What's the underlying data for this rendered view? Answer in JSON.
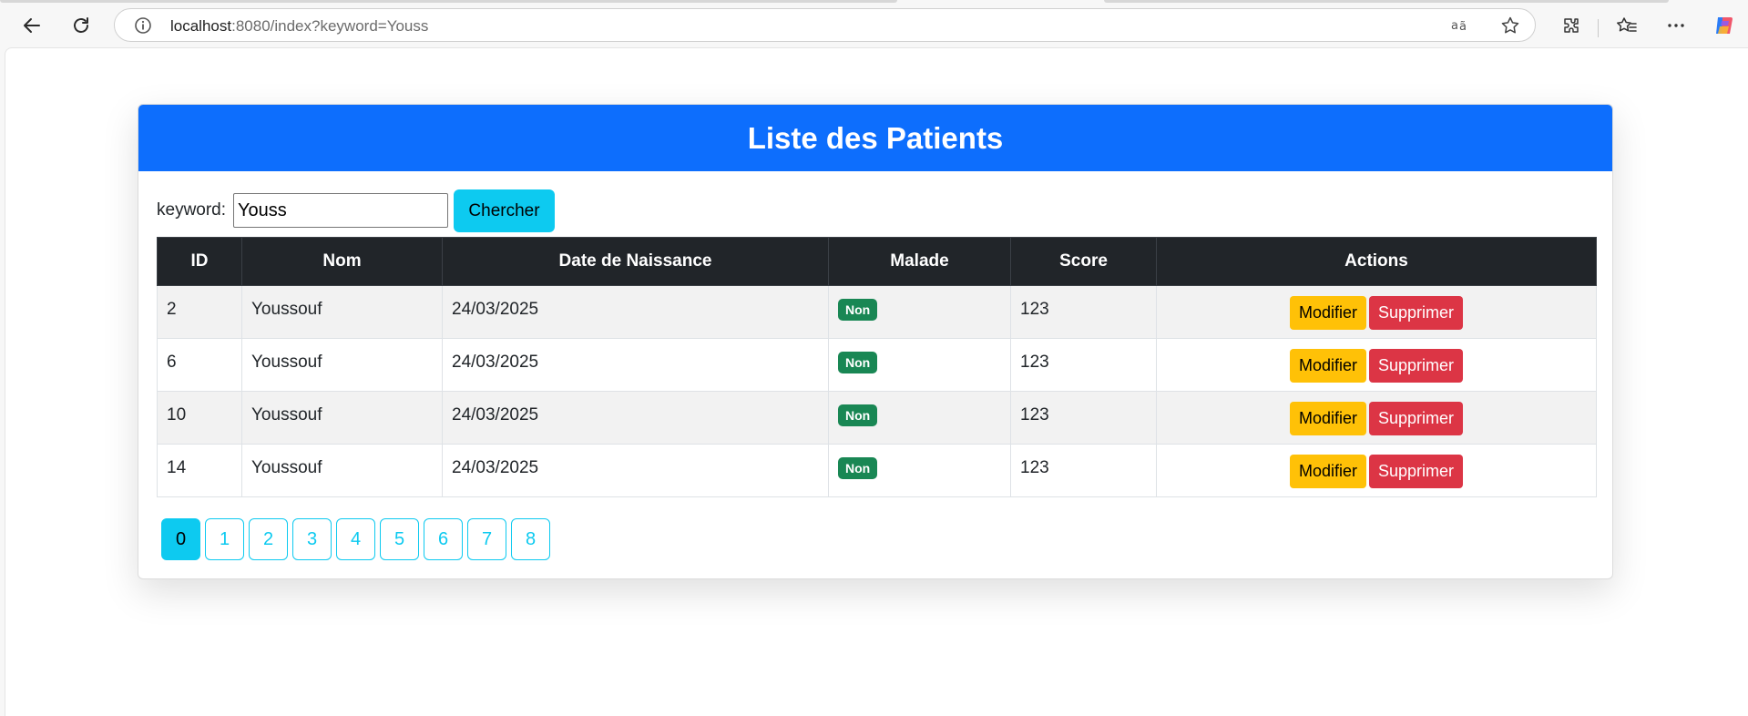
{
  "browser": {
    "url_host": "localhost",
    "url_rest": ":8080/index?keyword=Youss"
  },
  "page": {
    "title": "Liste des Patients",
    "search": {
      "label": "keyword:",
      "value": "Youss",
      "button": "Chercher"
    },
    "table": {
      "headers": [
        "ID",
        "Nom",
        "Date de Naissance",
        "Malade",
        "Score",
        "Actions"
      ],
      "rows": [
        {
          "id": "2",
          "nom": "Youssouf",
          "date": "24/03/2025",
          "malade": "Non",
          "score": "123"
        },
        {
          "id": "6",
          "nom": "Youssouf",
          "date": "24/03/2025",
          "malade": "Non",
          "score": "123"
        },
        {
          "id": "10",
          "nom": "Youssouf",
          "date": "24/03/2025",
          "malade": "Non",
          "score": "123"
        },
        {
          "id": "14",
          "nom": "Youssouf",
          "date": "24/03/2025",
          "malade": "Non",
          "score": "123"
        }
      ],
      "edit_label": "Modifier",
      "delete_label": "Supprimer"
    },
    "pagination": {
      "pages": [
        "0",
        "1",
        "2",
        "3",
        "4",
        "5",
        "6",
        "7",
        "8"
      ],
      "active": "0"
    }
  },
  "colors": {
    "header": "#0d6efd",
    "info": "#0dcaf0",
    "success": "#198754",
    "warning": "#ffc107",
    "danger": "#dc3545",
    "dark": "#212529"
  }
}
